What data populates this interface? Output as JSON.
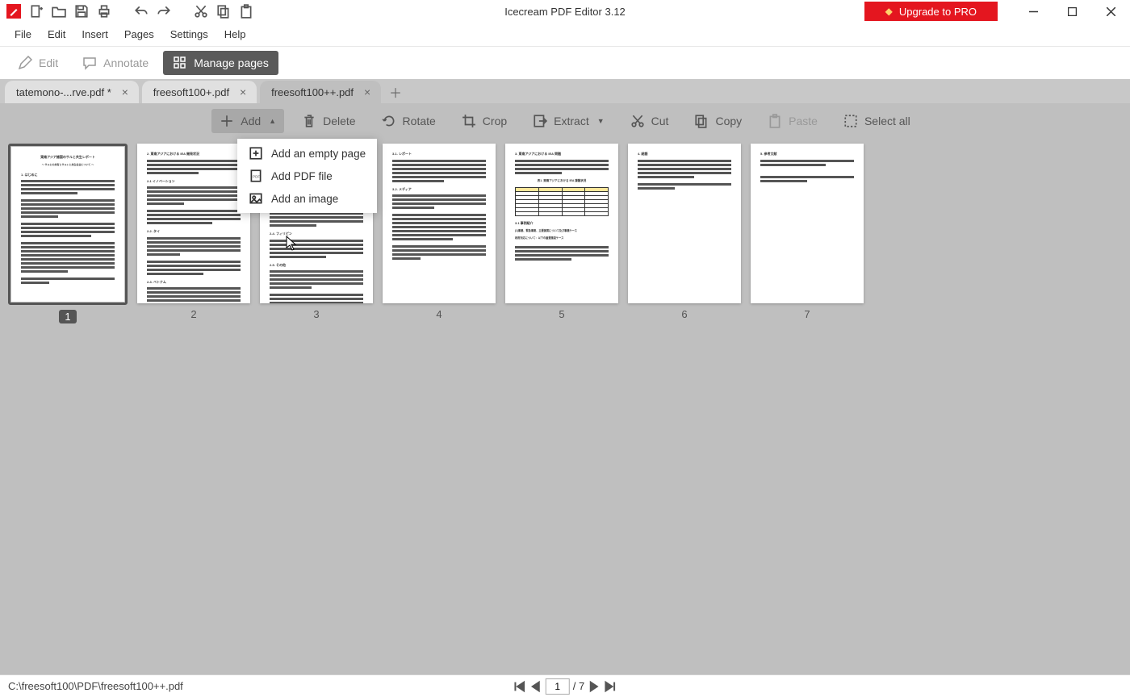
{
  "app": {
    "title": "Icecream PDF Editor 3.12",
    "upgrade_label": "Upgrade to PRO"
  },
  "menu": {
    "file": "File",
    "edit": "Edit",
    "insert": "Insert",
    "pages": "Pages",
    "settings": "Settings",
    "help": "Help"
  },
  "modes": {
    "edit": "Edit",
    "annotate": "Annotate",
    "manage_pages": "Manage pages"
  },
  "tabs": {
    "items": [
      {
        "label": "tatemono-...rve.pdf *"
      },
      {
        "label": "freesoft100+.pdf"
      },
      {
        "label": "freesoft100++.pdf"
      }
    ]
  },
  "actions": {
    "add": "Add",
    "delete": "Delete",
    "rotate": "Rotate",
    "crop": "Crop",
    "extract": "Extract",
    "cut": "Cut",
    "copy": "Copy",
    "paste": "Paste",
    "select_all": "Select all"
  },
  "add_menu": {
    "empty_page": "Add an empty page",
    "pdf_file": "Add PDF file",
    "image": "Add an image"
  },
  "pages": {
    "count": 7,
    "selected": 1,
    "labels": [
      "1",
      "2",
      "3",
      "4",
      "5",
      "6",
      "7"
    ]
  },
  "status": {
    "path": "C:\\freesoft100\\PDF\\freesoft100++.pdf",
    "current_page": "1",
    "total_pages": "/ 7"
  }
}
